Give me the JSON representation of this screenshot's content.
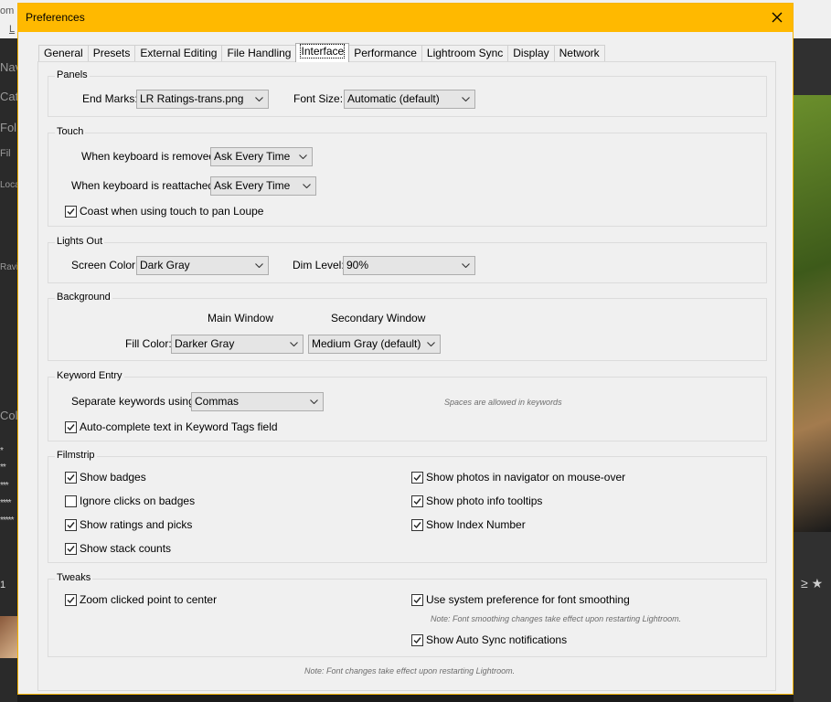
{
  "background": {
    "top_text_1": "om",
    "top_text_2": "L",
    "left_labels": [
      "Nav",
      "Cat",
      "Fol",
      "Fil",
      "Loca",
      "Ravi",
      "Col"
    ],
    "left_stars": [
      "*",
      "**",
      "***",
      "****",
      "*****"
    ],
    "left_number": "1"
  },
  "dialog": {
    "title": "Preferences",
    "close_icon": "close-icon",
    "accent_color": "#ffb900"
  },
  "tabs": [
    {
      "label": "General",
      "active": false
    },
    {
      "label": "Presets",
      "active": false
    },
    {
      "label": "External Editing",
      "active": false
    },
    {
      "label": "File Handling",
      "active": false
    },
    {
      "label": "Interface",
      "active": true
    },
    {
      "label": "Performance",
      "active": false
    },
    {
      "label": "Lightroom Sync",
      "active": false
    },
    {
      "label": "Display",
      "active": false
    },
    {
      "label": "Network",
      "active": false
    }
  ],
  "panels": {
    "title": "Panels",
    "end_marks_label": "End Marks:",
    "end_marks_value": "LR Ratings-trans.png",
    "font_size_label": "Font Size:",
    "font_size_value": "Automatic (default)"
  },
  "touch": {
    "title": "Touch",
    "removed_label": "When keyboard is removed:",
    "removed_value": "Ask Every Time",
    "reattached_label": "When keyboard is reattached:",
    "reattached_value": "Ask Every Time",
    "coast_label": "Coast when using touch to pan Loupe",
    "coast_checked": true
  },
  "lights_out": {
    "title": "Lights Out",
    "screen_color_label": "Screen Color:",
    "screen_color_value": "Dark Gray",
    "dim_level_label": "Dim Level:",
    "dim_level_value": "90%"
  },
  "background_group": {
    "title": "Background",
    "main_window_label": "Main Window",
    "secondary_window_label": "Secondary Window",
    "fill_color_label": "Fill Color:",
    "main_value": "Darker Gray",
    "secondary_value": "Medium Gray (default)"
  },
  "keyword_entry": {
    "title": "Keyword Entry",
    "separate_label": "Separate keywords using:",
    "separate_value": "Commas",
    "hint": "Spaces are allowed in keywords",
    "autocomplete_label": "Auto-complete text in Keyword Tags field",
    "autocomplete_checked": true
  },
  "filmstrip": {
    "title": "Filmstrip",
    "left": [
      {
        "label": "Show badges",
        "checked": true
      },
      {
        "label": "Ignore clicks on badges",
        "checked": false
      },
      {
        "label": "Show ratings and picks",
        "checked": true
      },
      {
        "label": "Show stack counts",
        "checked": true
      }
    ],
    "right": [
      {
        "label": "Show photos in navigator on mouse-over",
        "checked": true
      },
      {
        "label": "Show photo info tooltips",
        "checked": true
      },
      {
        "label": "Show Index Number",
        "checked": true
      }
    ]
  },
  "tweaks": {
    "title": "Tweaks",
    "zoom_label": "Zoom clicked point to center",
    "zoom_checked": true,
    "smoothing_label": "Use system preference for font smoothing",
    "smoothing_checked": true,
    "smoothing_note": "Note: Font smoothing changes take effect upon restarting Lightroom.",
    "autosync_label": "Show Auto Sync notifications",
    "autosync_checked": true
  },
  "footer_note": "Note: Font changes take effect upon restarting Lightroom."
}
